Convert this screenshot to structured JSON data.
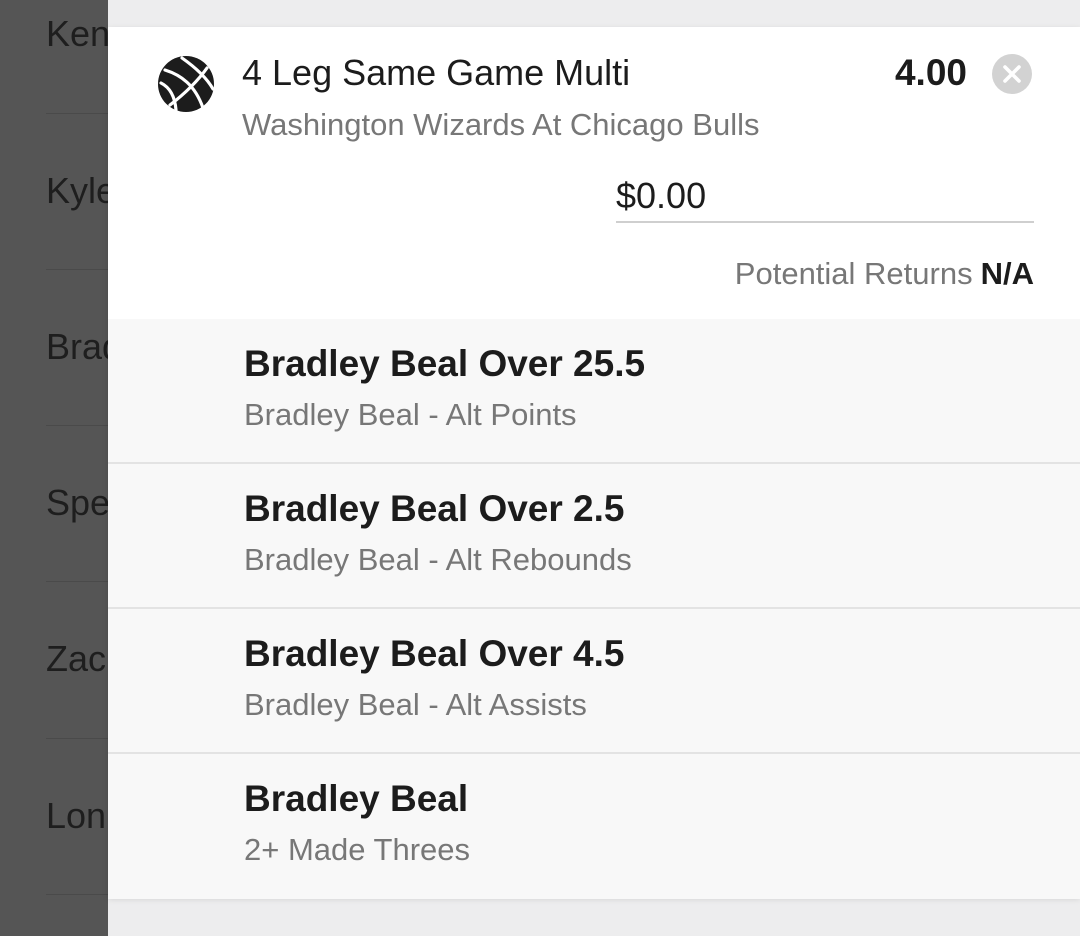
{
  "background_list": {
    "items": [
      "Ken",
      "Kyle",
      "Brad",
      "Spe",
      "Zac",
      "Lon"
    ]
  },
  "bet": {
    "icon": "basketball-icon",
    "title": "4 Leg Same Game Multi",
    "odds": "4.00",
    "event": "Washington Wizards At Chicago Bulls",
    "stake_value": "$0.00",
    "returns_label": "Potential Returns",
    "returns_value": "N/A",
    "legs": [
      {
        "title": "Bradley Beal Over 25.5",
        "subtitle": "Bradley Beal - Alt Points"
      },
      {
        "title": "Bradley Beal Over 2.5",
        "subtitle": "Bradley Beal - Alt Rebounds"
      },
      {
        "title": "Bradley Beal Over 4.5",
        "subtitle": "Bradley Beal - Alt Assists"
      },
      {
        "title": "Bradley Beal",
        "subtitle": "2+ Made Threes"
      }
    ]
  },
  "colors": {
    "overlay": "#555555",
    "card": "#ffffff",
    "leg_background": "#f8f8f8",
    "primary_text": "#1c1c1c",
    "secondary_text": "#777777",
    "close_button": "#d2d2d2"
  }
}
